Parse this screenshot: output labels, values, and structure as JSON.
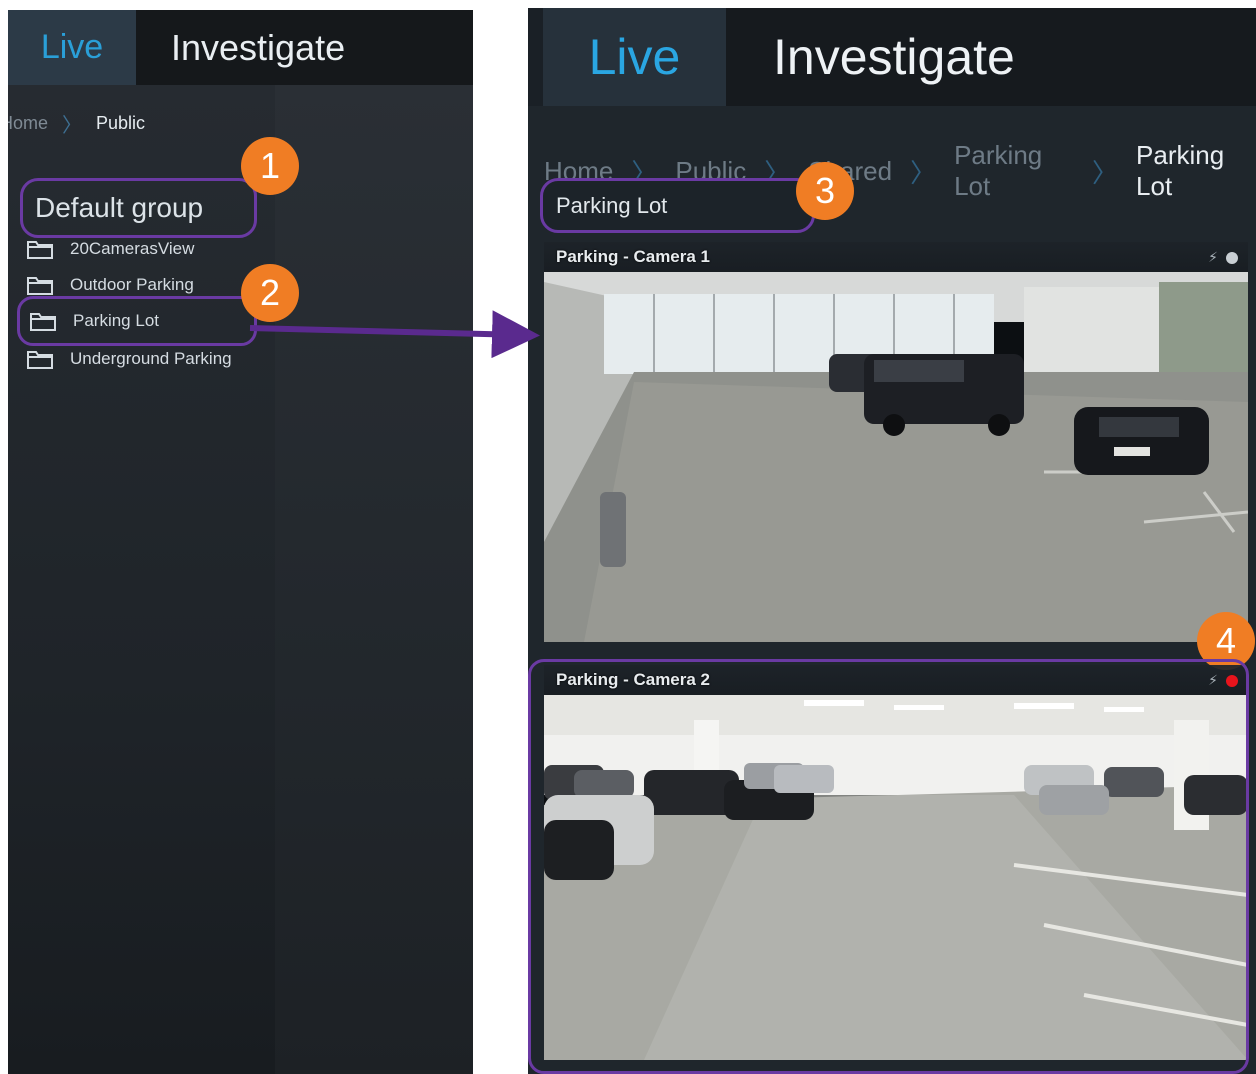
{
  "left": {
    "tabs": {
      "live": "Live",
      "investigate": "Investigate"
    },
    "breadcrumb": {
      "home": "Home",
      "current": "Public"
    },
    "group_title": "Default group",
    "items": [
      {
        "label": "20CamerasView"
      },
      {
        "label": "Outdoor Parking"
      },
      {
        "label": "Parking Lot"
      },
      {
        "label": "Underground Parking"
      }
    ]
  },
  "right": {
    "tabs": {
      "live": "Live",
      "investigate": "Investigate"
    },
    "breadcrumb": [
      "Home",
      "Public",
      "Shared",
      "Parking Lot",
      "Parking Lot"
    ],
    "view_title": "Parking Lot",
    "cameras": [
      {
        "label": "Parking - Camera 1",
        "motion_icon": "motion-icon",
        "status_color": "#c9cfd4"
      },
      {
        "label": "Parking - Camera 2",
        "motion_icon": "motion-icon",
        "status_color": "#e8141c"
      }
    ]
  },
  "callouts": [
    "1",
    "2",
    "3",
    "4"
  ],
  "colors": {
    "accent_live": "#2a9fd8",
    "highlight_outline": "#6a3aa3",
    "callout": "#f07d24",
    "recording": "#e8141c"
  }
}
